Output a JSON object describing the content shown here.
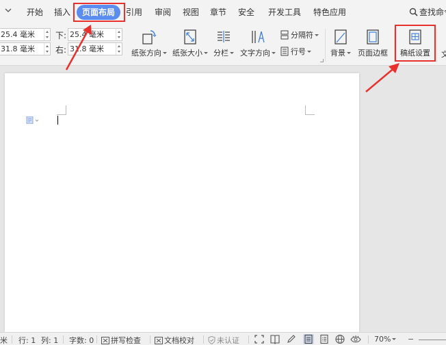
{
  "tabs": {
    "menu_chev": "chevron-down-icon",
    "items": [
      "开始",
      "插入",
      "页面布局",
      "引用",
      "审阅",
      "视图",
      "章节",
      "安全",
      "开发工具",
      "特色应用"
    ],
    "active": "页面布局",
    "search_label": "查找命令"
  },
  "ribbon": {
    "margins": {
      "top_value": "25.4 毫米",
      "bottom_label": "下:",
      "bottom_value": "25.4 毫米",
      "left_value": "31.8 毫米",
      "right_label": "右:",
      "right_value": "31.8 毫米"
    },
    "buttons": {
      "orientation": "纸张方向",
      "size": "纸张大小",
      "columns": "分栏",
      "text_direction": "文字方向",
      "separator": "分隔符",
      "line_number": "行号",
      "background": "背景",
      "page_border": "页面边框",
      "draft_paper": "稿纸设置",
      "cut_off": "文"
    }
  },
  "status_bar": {
    "unit_partial": "米",
    "row": "行: 1",
    "col": "列: 1",
    "word_count": "字数: 0",
    "spell_check": "拼写检查",
    "doc_proof": "文档校对",
    "cert": "未认证",
    "zoom": "70%"
  },
  "colors": {
    "active_tab": "#5b8def",
    "annotation_red": "#e8302d",
    "page": "#ffffff"
  }
}
